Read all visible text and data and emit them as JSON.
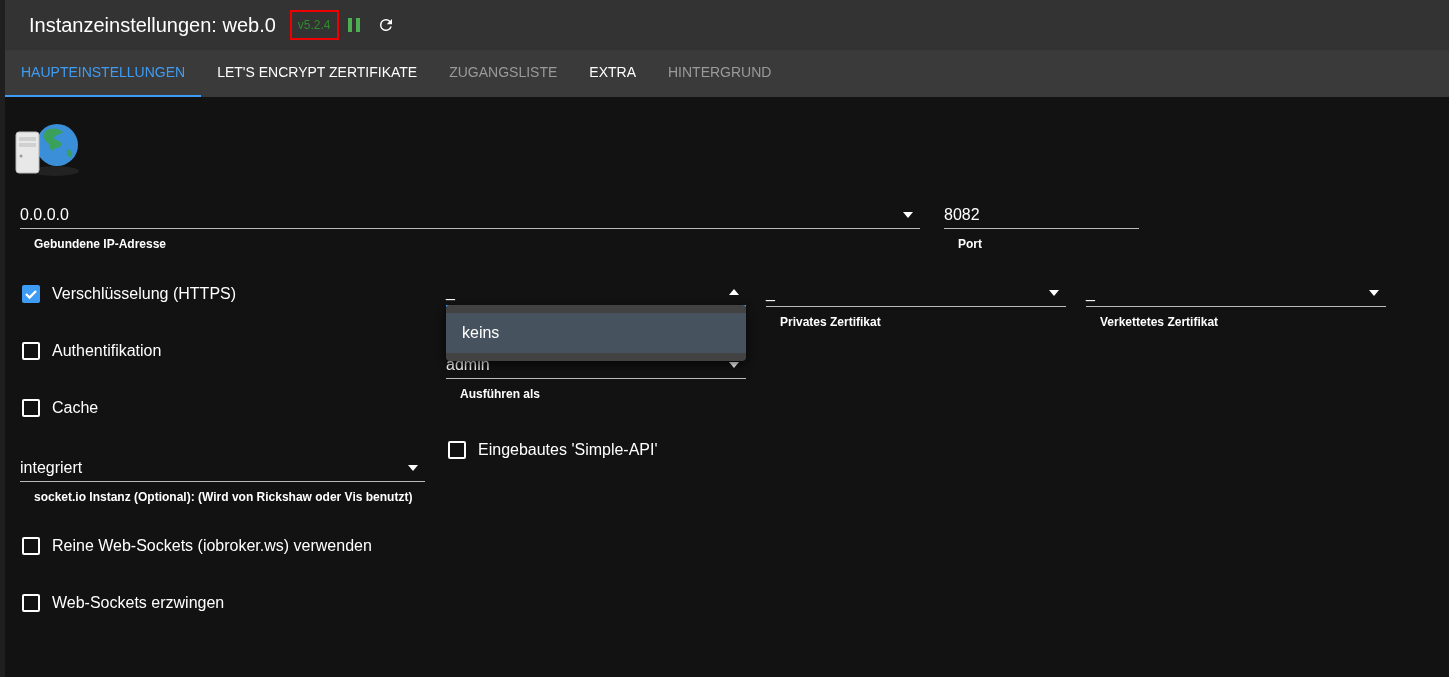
{
  "header": {
    "title": "Instanzeinstellungen: web.0",
    "version": "v5.2.4",
    "running": true
  },
  "tabs": [
    {
      "label": "HAUPTEINSTELLUNGEN",
      "selected": true,
      "disabled": false
    },
    {
      "label": "LET'S ENCRYPT ZERTIFIKATE",
      "selected": false,
      "disabled": false
    },
    {
      "label": "ZUGANGSLISTE",
      "selected": false,
      "disabled": true
    },
    {
      "label": "EXTRA",
      "selected": false,
      "disabled": false
    },
    {
      "label": "HINTERGRUND",
      "selected": false,
      "disabled": true
    }
  ],
  "ip_select": {
    "value": "0.0.0.0",
    "label": "Gebundene IP-Adresse"
  },
  "port_field": {
    "value": "8082",
    "label": "Port"
  },
  "left_items": [
    {
      "kind": "checkbox",
      "label": "Verschlüsselung (HTTPS)",
      "checked": true
    },
    {
      "kind": "checkbox",
      "label": "Authentifikation",
      "checked": false
    },
    {
      "kind": "checkbox",
      "label": "Cache",
      "checked": false
    },
    {
      "kind": "select",
      "value": "integriert",
      "label": "socket.io Instanz (Optional): (Wird von Rickshaw oder Vis benutzt)"
    },
    {
      "kind": "checkbox",
      "label": "Reine Web-Sockets (iobroker.ws) verwenden",
      "checked": false
    },
    {
      "kind": "checkbox",
      "label": "Web-Sockets erzwingen",
      "checked": false
    }
  ],
  "certificates": [
    {
      "value": "_",
      "expanded": true
    },
    {
      "value": "_",
      "label": "Privates Zertifikat",
      "expanded": false
    },
    {
      "value": "_",
      "label": "Verkettetes Zertifikat",
      "expanded": false
    }
  ],
  "dropdown_menu": {
    "items": [
      {
        "label": "keins",
        "selected": true
      }
    ]
  },
  "run_as": {
    "value": "admin",
    "label": "Ausführen als"
  },
  "simple_api": {
    "label": "Eingebautes 'Simple-API'",
    "checked": false
  }
}
